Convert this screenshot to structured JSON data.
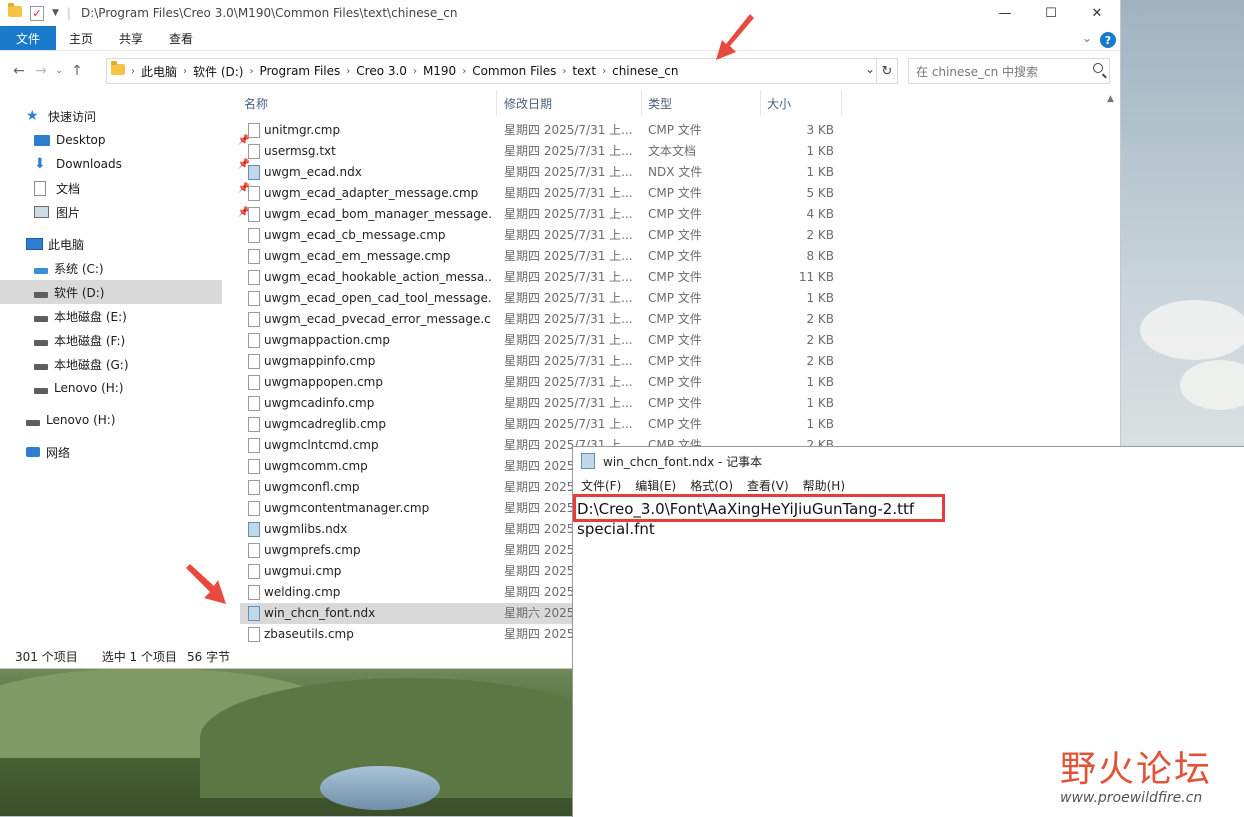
{
  "explorer": {
    "title_path": "D:\\Program Files\\Creo 3.0\\M190\\Common Files\\text\\chinese_cn",
    "ribbon_tabs": [
      "文件",
      "主页",
      "共享",
      "查看"
    ],
    "breadcrumbs": [
      "此电脑",
      "软件 (D:)",
      "Program Files",
      "Creo 3.0",
      "M190",
      "Common Files",
      "text",
      "chinese_cn"
    ],
    "search_placeholder": "在 chinese_cn 中搜索",
    "columns": {
      "name": "名称",
      "date": "修改日期",
      "type": "类型",
      "size": "大小"
    },
    "nav": {
      "quick_access": "快速访问",
      "desktop": "Desktop",
      "downloads": "Downloads",
      "documents": "文档",
      "pictures": "图片",
      "this_pc": "此电脑",
      "drive_c": "系统 (C:)",
      "drive_d": "软件 (D:)",
      "drive_e": "本地磁盘 (E:)",
      "drive_f": "本地磁盘 (F:)",
      "drive_g": "本地磁盘 (G:)",
      "drive_h_sub": "Lenovo (H:)",
      "drive_h": "Lenovo (H:)",
      "network": "网络"
    },
    "files": [
      {
        "name": "unitmgr.cmp",
        "date": "星期四 2025/7/31 上...",
        "type": "CMP 文件",
        "size": "3 KB",
        "icon": "file"
      },
      {
        "name": "usermsg.txt",
        "date": "星期四 2025/7/31 上...",
        "type": "文本文档",
        "size": "1 KB",
        "icon": "file"
      },
      {
        "name": "uwgm_ecad.ndx",
        "date": "星期四 2025/7/31 上...",
        "type": "NDX 文件",
        "size": "1 KB",
        "icon": "ndx"
      },
      {
        "name": "uwgm_ecad_adapter_message.cmp",
        "date": "星期四 2025/7/31 上...",
        "type": "CMP 文件",
        "size": "5 KB",
        "icon": "file"
      },
      {
        "name": "uwgm_ecad_bom_manager_message....",
        "date": "星期四 2025/7/31 上...",
        "type": "CMP 文件",
        "size": "4 KB",
        "icon": "file"
      },
      {
        "name": "uwgm_ecad_cb_message.cmp",
        "date": "星期四 2025/7/31 上...",
        "type": "CMP 文件",
        "size": "2 KB",
        "icon": "file"
      },
      {
        "name": "uwgm_ecad_em_message.cmp",
        "date": "星期四 2025/7/31 上...",
        "type": "CMP 文件",
        "size": "8 KB",
        "icon": "file"
      },
      {
        "name": "uwgm_ecad_hookable_action_messa...",
        "date": "星期四 2025/7/31 上...",
        "type": "CMP 文件",
        "size": "11 KB",
        "icon": "file"
      },
      {
        "name": "uwgm_ecad_open_cad_tool_message....",
        "date": "星期四 2025/7/31 上...",
        "type": "CMP 文件",
        "size": "1 KB",
        "icon": "file"
      },
      {
        "name": "uwgm_ecad_pvecad_error_message.c...",
        "date": "星期四 2025/7/31 上...",
        "type": "CMP 文件",
        "size": "2 KB",
        "icon": "file"
      },
      {
        "name": "uwgmappaction.cmp",
        "date": "星期四 2025/7/31 上...",
        "type": "CMP 文件",
        "size": "2 KB",
        "icon": "file"
      },
      {
        "name": "uwgmappinfo.cmp",
        "date": "星期四 2025/7/31 上...",
        "type": "CMP 文件",
        "size": "2 KB",
        "icon": "file"
      },
      {
        "name": "uwgmappopen.cmp",
        "date": "星期四 2025/7/31 上...",
        "type": "CMP 文件",
        "size": "1 KB",
        "icon": "file"
      },
      {
        "name": "uwgmcadinfo.cmp",
        "date": "星期四 2025/7/31 上...",
        "type": "CMP 文件",
        "size": "1 KB",
        "icon": "file"
      },
      {
        "name": "uwgmcadreglib.cmp",
        "date": "星期四 2025/7/31 上...",
        "type": "CMP 文件",
        "size": "1 KB",
        "icon": "file"
      },
      {
        "name": "uwgmclntcmd.cmp",
        "date": "星期四 2025/7/31 上...",
        "type": "CMP 文件",
        "size": "2 KB",
        "icon": "file"
      },
      {
        "name": "uwgmcomm.cmp",
        "date": "星期四 2025",
        "type": "",
        "size": "",
        "icon": "file"
      },
      {
        "name": "uwgmconfl.cmp",
        "date": "星期四 2025",
        "type": "",
        "size": "",
        "icon": "file"
      },
      {
        "name": "uwgmcontentmanager.cmp",
        "date": "星期四 2025",
        "type": "",
        "size": "",
        "icon": "file"
      },
      {
        "name": "uwgmlibs.ndx",
        "date": "星期四 2025",
        "type": "",
        "size": "",
        "icon": "ndx"
      },
      {
        "name": "uwgmprefs.cmp",
        "date": "星期四 2025",
        "type": "",
        "size": "",
        "icon": "file"
      },
      {
        "name": "uwgmui.cmp",
        "date": "星期四 2025",
        "type": "",
        "size": "",
        "icon": "file"
      },
      {
        "name": "welding.cmp",
        "date": "星期四 2025",
        "type": "",
        "size": "",
        "icon": "file"
      },
      {
        "name": "win_chcn_font.ndx",
        "date": "星期六 2025",
        "type": "",
        "size": "",
        "icon": "ndx",
        "selected": true
      },
      {
        "name": "zbaseutils.cmp",
        "date": "星期四 2025",
        "type": "",
        "size": "",
        "icon": "file"
      }
    ],
    "status": {
      "count": "301 个项目",
      "selected": "选中 1 个项目",
      "size": "56 字节"
    }
  },
  "notepad": {
    "title": "win_chcn_font.ndx - 记事本",
    "menu": [
      "文件(F)",
      "编辑(E)",
      "格式(O)",
      "查看(V)",
      "帮助(H)"
    ],
    "lines": [
      "D:\\Creo_3.0\\Font\\AaXingHeYiJiuGunTang-2.ttf",
      "special.fnt"
    ]
  },
  "watermark": {
    "title": "野火论坛",
    "url": "www.proewildfire.cn"
  },
  "colors": {
    "accent": "#1979ca",
    "highlight": "#e83b3b",
    "selection": "#d9d9d9"
  }
}
